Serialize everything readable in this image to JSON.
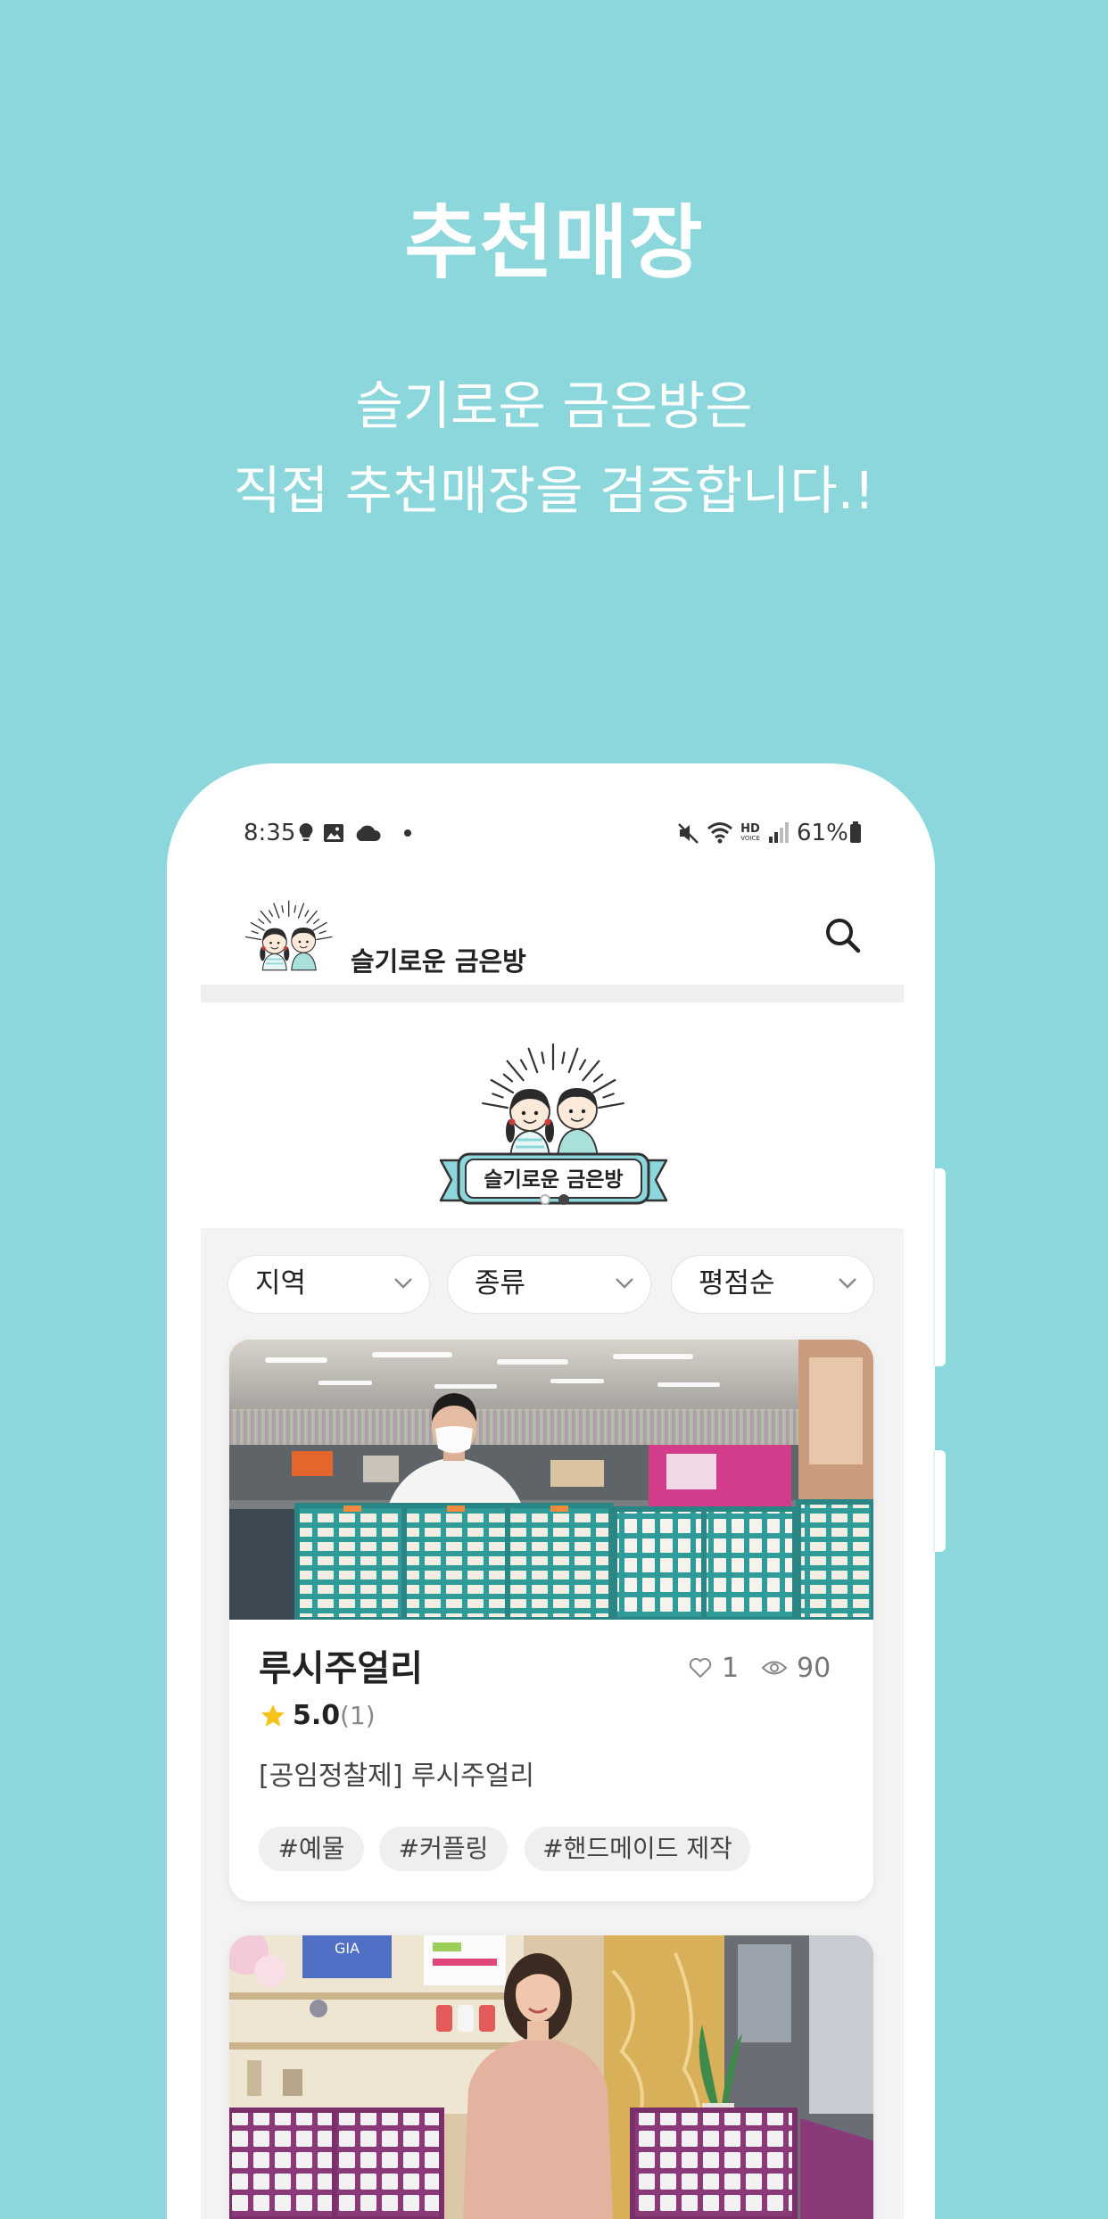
{
  "colors": {
    "background": "#8cd7db",
    "title_text": "#ffffff",
    "screen": "#ffffff",
    "content_bg": "#f3f3f3",
    "star": "#f6c21c",
    "tag_bg": "#efefef",
    "primary_text": "#222222",
    "secondary_text": "#777777"
  },
  "hero": {
    "title": "추천매장",
    "subtitle_line1": "슬기로운 금은방은",
    "subtitle_line2": "직접 추천매장을 검증합니다.!"
  },
  "status_bar": {
    "time": "8:35",
    "battery_percent": "61%",
    "hd_label": "HD",
    "voice_label": "VOICE",
    "left_icons": [
      "bulb-icon",
      "gallery-icon",
      "cloud-icon",
      "dot-icon"
    ],
    "right_icons": [
      "mute-icon",
      "wifi-icon",
      "hd-voice-icon",
      "signal-icon",
      "battery-icon"
    ]
  },
  "app_header": {
    "logo_text": "슬기로운 금은방",
    "search_icon": "search-icon"
  },
  "banner": {
    "logo_text": "슬기로운 금은방",
    "slide_count": 2,
    "active_slide": 2
  },
  "filters": [
    {
      "label": "지역",
      "icon": "chevron-down-icon"
    },
    {
      "label": "종류",
      "icon": "chevron-down-icon"
    },
    {
      "label": "평점순",
      "icon": "chevron-down-icon"
    }
  ],
  "stores": [
    {
      "name": "루시주얼리",
      "likes": "1",
      "views": "90",
      "rating": "5.0",
      "review_count": "(1)",
      "description": "[공임정찰제] 루시주얼리",
      "tags": [
        "#예물",
        "#커플링",
        "#핸드메이드 제작"
      ],
      "like_icon": "heart-icon",
      "view_icon": "eye-icon",
      "rating_icon": "star-icon"
    },
    {
      "photo_sign": "GIA"
    }
  ]
}
